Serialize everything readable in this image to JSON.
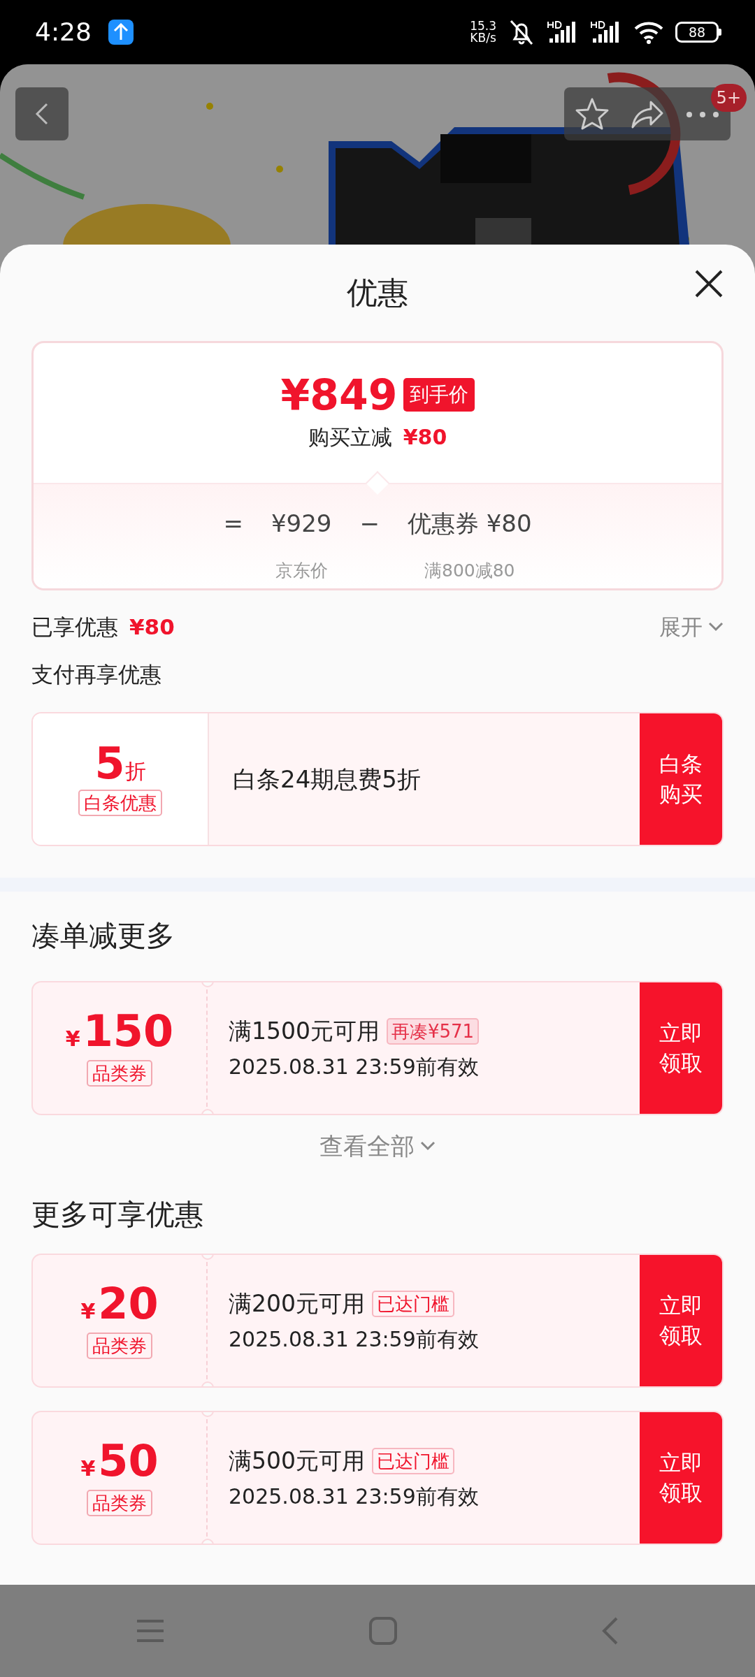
{
  "status_bar": {
    "time": "4:28",
    "net_speed_value": "15.3",
    "net_speed_unit": "KB/s",
    "battery": "88"
  },
  "header": {
    "cart_badge": "5+"
  },
  "sheet": {
    "title": "优惠"
  },
  "price_card": {
    "final_price": "¥849",
    "final_tag": "到手价",
    "instant_label": "购买立减",
    "instant_amount": "¥80",
    "equals": "=",
    "base_price": "¥929",
    "minus": "−",
    "coupon_price": "优惠券 ¥80",
    "base_caption": "京东价",
    "coupon_caption": "满800减80"
  },
  "savings": {
    "label": "已享优惠",
    "amount": "¥80",
    "toggle": "展开"
  },
  "payment": {
    "title": "支付再享优惠",
    "offer": {
      "discount": "5",
      "discount_unit": "折",
      "tag": "白条优惠",
      "description": "白条24期息费5折",
      "action": "白条购买"
    }
  },
  "sections": [
    {
      "title": "凑单减更多",
      "more_link": "查看全部",
      "coupons": [
        {
          "currency": "¥",
          "amount": "150",
          "tag": "品类券",
          "condition": "满1500元可用",
          "badge": "再凑¥571",
          "badge_filled": true,
          "validity": "2025.08.31 23:59前有效",
          "action": "立即领取"
        }
      ]
    },
    {
      "title": "更多可享优惠",
      "coupons": [
        {
          "currency": "¥",
          "amount": "20",
          "tag": "品类券",
          "condition": "满200元可用",
          "badge": "已达门槛",
          "badge_filled": false,
          "validity": "2025.08.31 23:59前有效",
          "action": "立即领取"
        },
        {
          "currency": "¥",
          "amount": "50",
          "tag": "品类券",
          "condition": "满500元可用",
          "badge": "已达门槛",
          "badge_filled": false,
          "validity": "2025.08.31 23:59前有效",
          "action": "立即领取"
        }
      ]
    }
  ]
}
